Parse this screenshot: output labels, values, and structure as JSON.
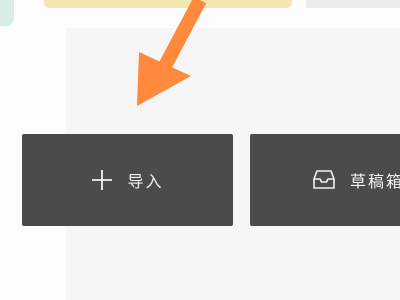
{
  "toolbar": {
    "import_label": "导入",
    "import_icon": "plus-icon",
    "drafts_label": "草稿箱",
    "drafts_icon": "inbox-tray-icon"
  },
  "annotation": {
    "arrow_color": "#ff8a3d",
    "points_to": "import-button"
  },
  "colors": {
    "button_bg": "#4b4b4b",
    "button_text": "#f2f2f2",
    "page_bg": "#f6f6f6"
  }
}
